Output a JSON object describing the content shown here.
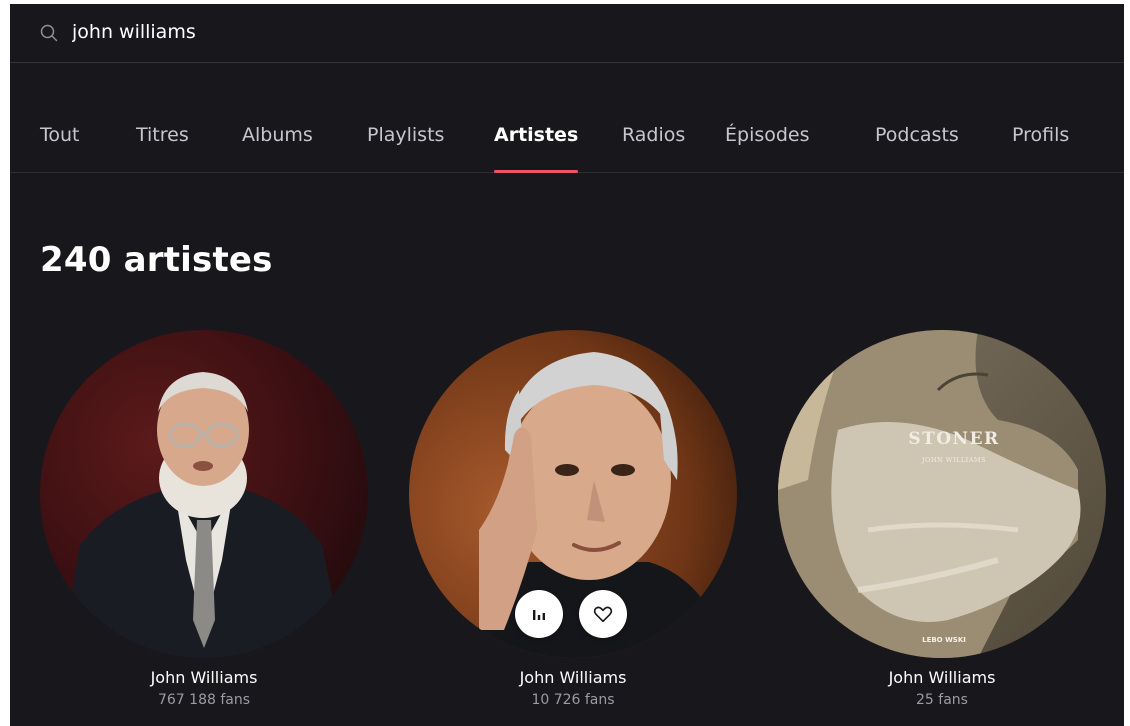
{
  "search": {
    "value": "john williams",
    "icon": "search-icon"
  },
  "tabs": [
    {
      "label": "Tout",
      "active": false
    },
    {
      "label": "Titres",
      "active": false
    },
    {
      "label": "Albums",
      "active": false
    },
    {
      "label": "Playlists",
      "active": false
    },
    {
      "label": "Artistes",
      "active": true
    },
    {
      "label": "Radios",
      "active": false
    },
    {
      "label": "Épisodes",
      "active": false
    },
    {
      "label": "Podcasts",
      "active": false
    },
    {
      "label": "Profils",
      "active": false
    }
  ],
  "results": {
    "heading": "240 artistes"
  },
  "artists": [
    {
      "name": "John Williams",
      "fans": "767 188 fans"
    },
    {
      "name": "John Williams",
      "fans": "10 726 fans"
    },
    {
      "name": "John Williams",
      "fans": "25 fans",
      "cover_title": "STONER",
      "cover_subtitle": "JOHN WILLIAMS",
      "cover_logo": "LEBO WSKI"
    }
  ],
  "colors": {
    "background": "#18171c",
    "accent": "#ef5466",
    "divider": "#2e2d34"
  }
}
